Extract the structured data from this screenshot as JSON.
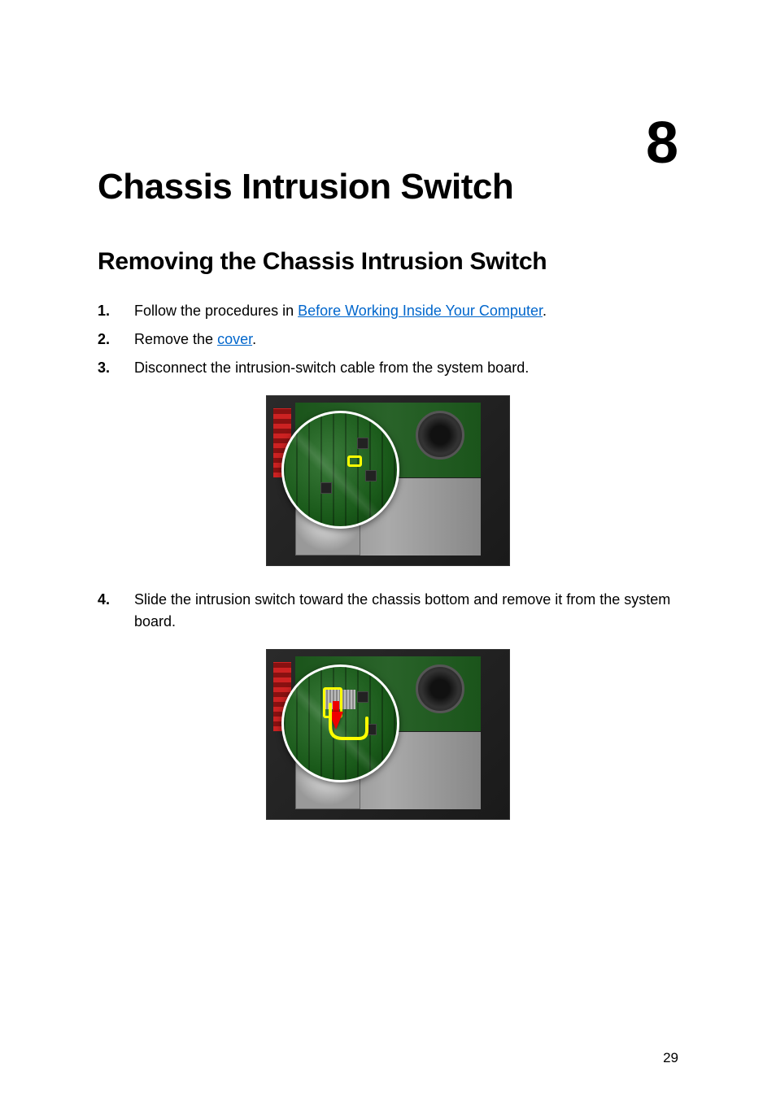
{
  "chapter": {
    "number": "8",
    "title": "Chassis Intrusion Switch"
  },
  "section": {
    "title": "Removing the Chassis Intrusion Switch"
  },
  "steps": [
    {
      "num": "1.",
      "text_before": "Follow the procedures in ",
      "link": "Before Working Inside Your Computer",
      "text_after": "."
    },
    {
      "num": "2.",
      "text_before": "Remove the ",
      "link": "cover",
      "text_after": "."
    },
    {
      "num": "3.",
      "text_before": "Disconnect the intrusion-switch cable from the system board.",
      "link": "",
      "text_after": ""
    },
    {
      "num": "4.",
      "text_before": "Slide the intrusion switch toward the chassis bottom and remove it from the system board.",
      "link": "",
      "text_after": ""
    }
  ],
  "page_number": "29"
}
